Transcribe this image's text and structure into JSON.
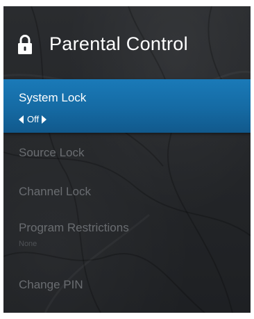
{
  "header": {
    "icon": "lock-icon",
    "title": "Parental Control"
  },
  "menu": {
    "items": [
      {
        "label": "System Lock",
        "value": "Off",
        "state": "selected"
      },
      {
        "label": "Source Lock",
        "state": "disabled"
      },
      {
        "label": "Channel Lock",
        "state": "disabled"
      },
      {
        "label": "Program Restrictions",
        "value": "None",
        "state": "disabled"
      },
      {
        "label": "Change PIN",
        "state": "disabled"
      }
    ]
  },
  "colors": {
    "panel_background": "#26282b",
    "selection_highlight": "#1a7ab8",
    "text_primary": "#ffffff",
    "text_disabled": "#6a6d71"
  }
}
